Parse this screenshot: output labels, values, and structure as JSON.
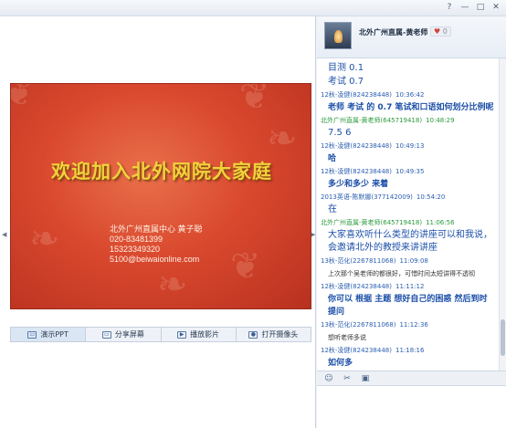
{
  "window": {
    "controls": [
      "?",
      "—",
      "□",
      "✕"
    ]
  },
  "slide": {
    "title": "欢迎加入北外网院大家庭",
    "contact": [
      "北外广州直属中心 黄子聪",
      "020-83481399",
      "15323349320",
      "5100@beiwaionline.com"
    ]
  },
  "toolbar": {
    "buttons": [
      {
        "label": "演示PPT",
        "icon": "presentation-icon"
      },
      {
        "label": "分享屏幕",
        "icon": "monitor-icon"
      },
      {
        "label": "播放影片",
        "icon": "film-icon"
      },
      {
        "label": "打开摄像头",
        "icon": "camera-icon"
      }
    ]
  },
  "profile": {
    "name": "北外广州直属-黄老师",
    "badge_count": "0"
  },
  "chat": [
    {
      "type": "body",
      "text": "目测 0.1",
      "style": "big"
    },
    {
      "type": "body",
      "text": "考试 0.7",
      "style": "big"
    },
    {
      "type": "meta",
      "user": "12秋-凌健(824238448)",
      "time": "10:36:42",
      "color": "blue"
    },
    {
      "type": "body",
      "text": "老师 考试 的 0.7 笔试和口语如何划分比例呢",
      "style": "bold"
    },
    {
      "type": "meta",
      "user": "北外广州直属-黄老师(645719418)",
      "time": "10:48:29",
      "color": "green"
    },
    {
      "type": "body",
      "text": "7.5 6",
      "style": "big"
    },
    {
      "type": "meta",
      "user": "12秋-凌健(824238448)",
      "time": "10:49:13",
      "color": "blue"
    },
    {
      "type": "body",
      "text": "哈",
      "style": "bold"
    },
    {
      "type": "meta",
      "user": "12秋-凌健(824238448)",
      "time": "10:49:35",
      "color": "blue"
    },
    {
      "type": "body",
      "text": "多少和多少 来着",
      "style": "bold"
    },
    {
      "type": "meta",
      "user": "2013英语-陈默娜(377142009)",
      "time": "10:54:20",
      "color": "blue"
    },
    {
      "type": "body",
      "text": "在",
      "style": "big"
    },
    {
      "type": "meta",
      "user": "北外广州直属-黄老师(645719418)",
      "time": "11:06:56",
      "color": "green"
    },
    {
      "type": "body",
      "text": "大家喜欢听什么类型的讲座可以和我说，会邀请北外的教授来讲讲座",
      "style": "big"
    },
    {
      "type": "meta",
      "user": "13秋-范化(2267811068)",
      "time": "11:09:08",
      "color": "blue"
    },
    {
      "type": "body",
      "text": "上次那个吴老师的都很好，可惜时间太短讲得不透彻",
      "style": "small"
    },
    {
      "type": "meta",
      "user": "12秋-凌健(824238448)",
      "time": "11:11:12",
      "color": "blue"
    },
    {
      "type": "body",
      "text": "你可以 根据 主题 想好自己的困惑 然后到时 提问",
      "style": "bold"
    },
    {
      "type": "meta",
      "user": "13秋-范化(2267811068)",
      "time": "11:12:36",
      "color": "blue"
    },
    {
      "type": "body",
      "text": "想听老师多说",
      "style": "small"
    },
    {
      "type": "meta",
      "user": "12秋-凌健(824238448)",
      "time": "11:18:16",
      "color": "blue"
    },
    {
      "type": "body",
      "text": "如何多",
      "style": "bold"
    }
  ],
  "input_toolbar": {
    "icons": [
      "☺",
      "✂",
      "▣"
    ]
  }
}
